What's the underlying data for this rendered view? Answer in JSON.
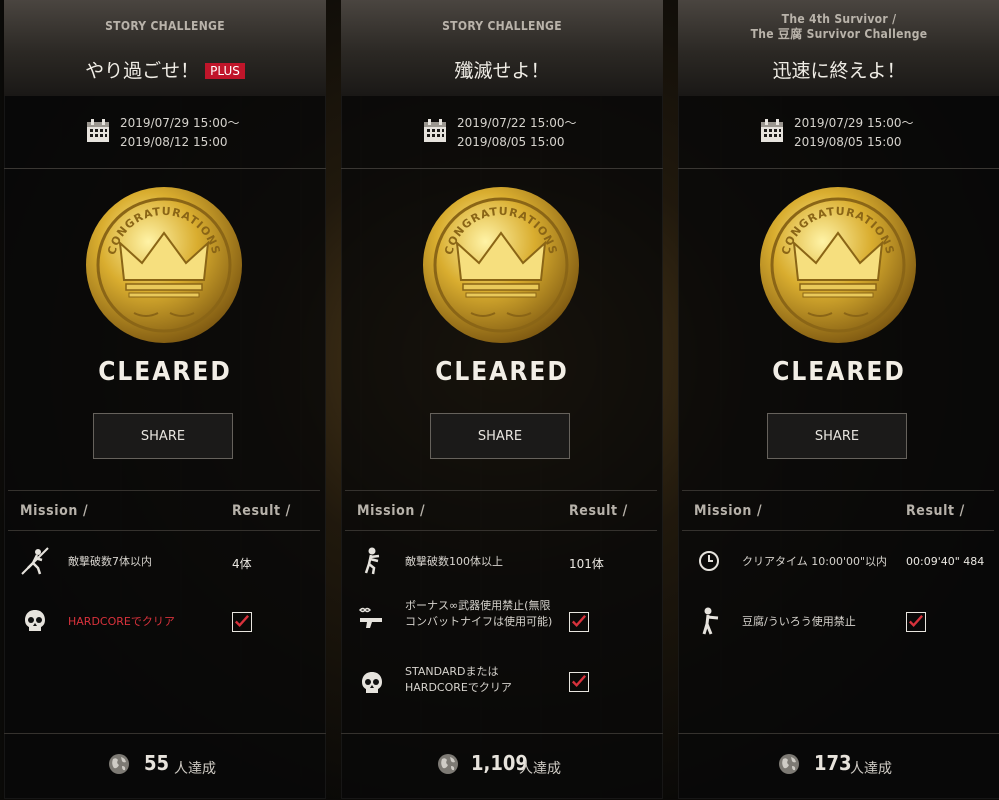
{
  "colors": {
    "accent_red": "#c0152a",
    "gold": "#c9a227",
    "check_red": "#d8323c"
  },
  "icons": {
    "calendar": "calendar-icon",
    "coin": "congratulations-crown-coin",
    "globe": "globe-icon"
  },
  "labels": {
    "cleared": "CLEARED",
    "share": "SHARE",
    "mission_header": "Mission /",
    "result_header": "Result /",
    "coin_text": "CONGRATURATIONS",
    "players_unit": "人達成"
  },
  "panels": [
    {
      "subtitle_lines": [
        "STORY CHALLENGE"
      ],
      "title": "やり過ごせ！",
      "badge": "PLUS",
      "date_start": "2019/07/29 15:00〜",
      "date_end": "2019/08/12 15:00",
      "missions": [
        {
          "icon": "running-enemy-icon",
          "text": "敵撃破数7体以内",
          "text_color": "normal",
          "result_text": "4体",
          "result_checked": false
        },
        {
          "icon": "skull-icon",
          "text": "HARDCOREでクリア",
          "text_color": "red",
          "result_text": "",
          "result_checked": true
        }
      ],
      "players": "55"
    },
    {
      "subtitle_lines": [
        "STORY CHALLENGE"
      ],
      "title": "殲滅せよ！",
      "badge": "",
      "date_start": "2019/07/22 15:00〜",
      "date_end": "2019/08/05 15:00",
      "missions": [
        {
          "icon": "zombie-icon",
          "text": "敵撃破数100体以上",
          "text_color": "normal",
          "result_text": "101体",
          "result_checked": false
        },
        {
          "icon": "infinite-gun-icon",
          "text": "ボーナス∞武器使用禁止(無限コンバットナイフは使用可能)",
          "text_color": "normal",
          "result_text": "",
          "result_checked": true
        },
        {
          "icon": "skull-icon",
          "text": "STANDARDまたはHARDCOREでクリア",
          "text_color": "normal",
          "result_text": "",
          "result_checked": true
        }
      ],
      "players": "1,109"
    },
    {
      "subtitle_lines": [
        "The 4th Survivor /",
        "The 豆腐 Survivor Challenge"
      ],
      "title": "迅速に終えよ！",
      "badge": "",
      "date_start": "2019/07/29 15:00〜",
      "date_end": "2019/08/05 15:00",
      "missions": [
        {
          "icon": "clock-icon",
          "text": "クリアタイム 10:00'00\"以内",
          "text_color": "normal",
          "result_text": "00:09'40\" 484",
          "result_checked": false
        },
        {
          "icon": "soldier-icon",
          "text": "豆腐/ういろう使用禁止",
          "text_color": "normal",
          "result_text": "",
          "result_checked": true
        }
      ],
      "players": "173"
    }
  ]
}
